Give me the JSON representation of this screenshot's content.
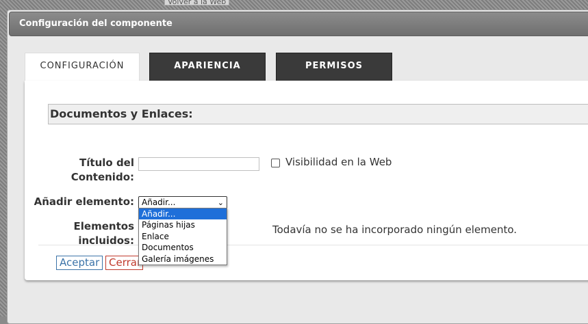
{
  "background": {
    "link_label": "Volver a la Web"
  },
  "dialog": {
    "title": "Configuración del componente"
  },
  "tabs": [
    {
      "label": "CONFIGURACIÓN",
      "active": true
    },
    {
      "label": "APARIENCIA",
      "active": false
    },
    {
      "label": "PERMISOS",
      "active": false
    }
  ],
  "section": {
    "title": "Documentos y Enlaces:"
  },
  "form": {
    "title_label_line1": "Título del",
    "title_label_line2": "Contenido:",
    "title_value": "",
    "visibility_label": "Visibilidad en la Web",
    "visibility_checked": false,
    "add_label": "Añadir elemento:",
    "add_selected": "Añadir...",
    "included_label_line1": "Elementos",
    "included_label_line2": "incluidos:",
    "empty_message": "Todavía no se ha incorporado ningún elemento."
  },
  "dropdown": {
    "options": [
      "Añadir...",
      "Páginas hijas",
      "Enlace",
      "Documentos",
      "Galería imágenes"
    ],
    "highlighted": "Añadir..."
  },
  "buttons": {
    "accept": "Aceptar",
    "close": "Cerrar"
  },
  "colors": {
    "tab_active_bg": "#ffffff",
    "tab_inactive_bg": "#3a3a3a",
    "accept": "#3b73a8",
    "close": "#c0392b",
    "highlight": "#1e6fd9"
  }
}
